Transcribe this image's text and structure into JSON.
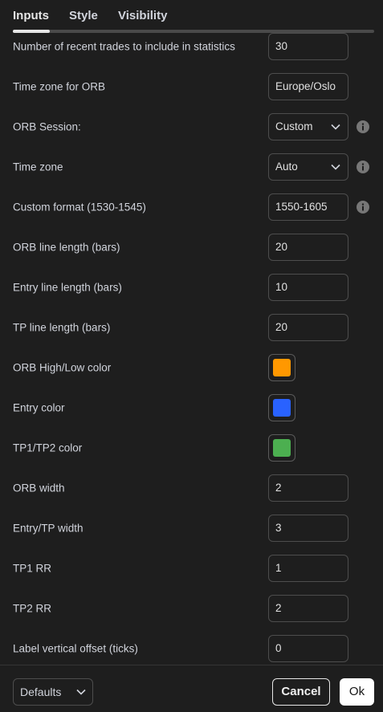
{
  "tabs": [
    {
      "label": "Inputs",
      "active": true
    },
    {
      "label": "Style",
      "active": false
    },
    {
      "label": "Visibility",
      "active": false
    }
  ],
  "inputs": {
    "recent_trades": {
      "label": "Number of recent trades to include in statistics",
      "value": "30"
    },
    "orb_timezone": {
      "label": "Time zone for ORB",
      "value": "Europe/Oslo"
    },
    "orb_session": {
      "label": "ORB Session:",
      "value": "Custom"
    },
    "time_zone": {
      "label": "Time zone",
      "value": "Auto"
    },
    "custom_format": {
      "label": "Custom format (1530-1545)",
      "value": "1550-1605"
    },
    "orb_line_length": {
      "label": "ORB line length (bars)",
      "value": "20"
    },
    "entry_line_length": {
      "label": "Entry line length (bars)",
      "value": "10"
    },
    "tp_line_length": {
      "label": "TP line length (bars)",
      "value": "20"
    },
    "orb_color": {
      "label": "ORB High/Low color",
      "color": "#ff9800"
    },
    "entry_color": {
      "label": "Entry color",
      "color": "#2962ff"
    },
    "tp_color": {
      "label": "TP1/TP2 color",
      "color": "#4caf50"
    },
    "orb_width": {
      "label": "ORB width",
      "value": "2"
    },
    "entry_tp_width": {
      "label": "Entry/TP width",
      "value": "3"
    },
    "tp1_rr": {
      "label": "TP1 RR",
      "value": "1"
    },
    "tp2_rr": {
      "label": "TP2 RR",
      "value": "2"
    },
    "label_offset": {
      "label": "Label vertical offset (ticks)",
      "value": "0"
    }
  },
  "icons": {
    "info": "info-icon",
    "chevron": "chevron-down-icon"
  },
  "footer": {
    "defaults_label": "Defaults",
    "cancel_label": "Cancel",
    "ok_label": "Ok"
  }
}
